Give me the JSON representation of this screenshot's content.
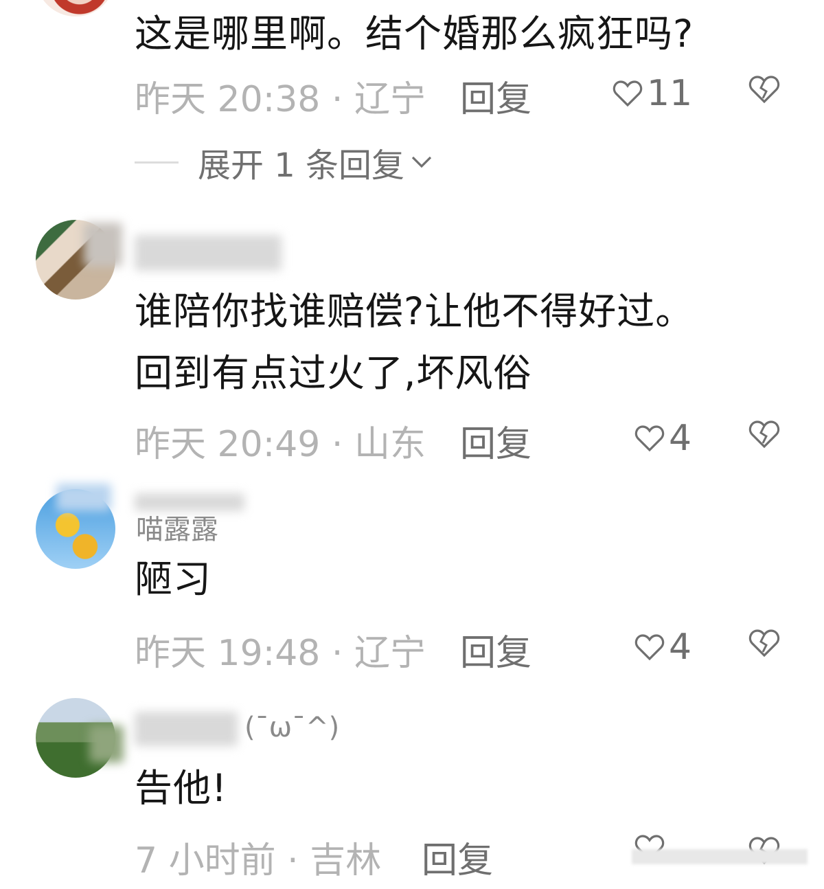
{
  "comments": [
    {
      "text": "这是哪里啊。结个婚那么疯狂吗?",
      "time_location": "昨天 20:38 · 辽宁",
      "reply_label": "回复",
      "likes": "11",
      "expand_label": "展开 1 条回复"
    },
    {
      "text": "谁陪你找谁赔偿?让他不得好过。\n回到有点过火了,坏风俗",
      "time_location": "昨天 20:49 · 山东",
      "reply_label": "回复",
      "likes": "4"
    },
    {
      "username": "喵露露",
      "text": "陋习",
      "time_location": "昨天 19:48 · 辽宁",
      "reply_label": "回复",
      "likes": "4"
    },
    {
      "username_suffix": "(¯ω¯^)",
      "text": "告他!",
      "time_location": "7 小时前 · 吉林",
      "reply_label": "回复"
    }
  ],
  "colors": {
    "text": "#161616",
    "meta": "#b3b3b3",
    "action": "#6f6f6f"
  },
  "icons": [
    "heart-outline-icon",
    "broken-heart-icon",
    "chevron-down-icon"
  ]
}
